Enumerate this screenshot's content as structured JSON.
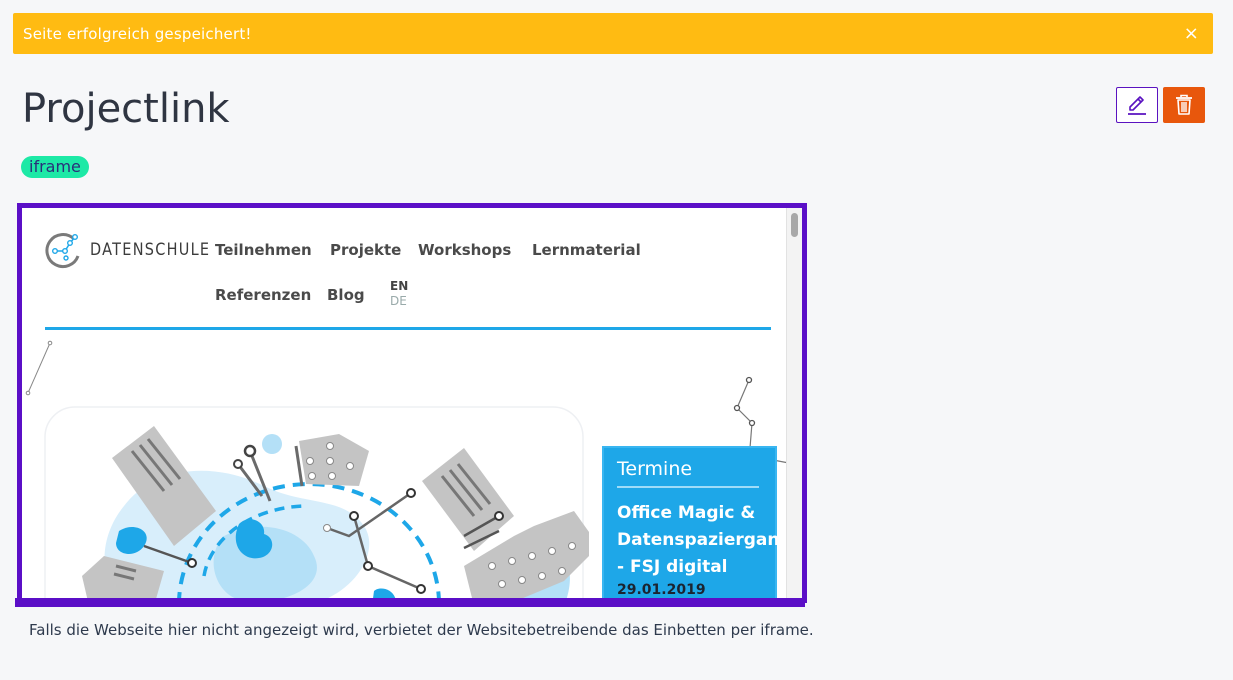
{
  "alert": {
    "message": "Seite erfolgreich gespeichert!",
    "close_label": "×"
  },
  "page": {
    "title": "Projectlink",
    "tag": "iframe"
  },
  "actions": {
    "edit_icon": "pencil-icon",
    "delete_icon": "trash-icon"
  },
  "colors": {
    "alert": "#ffbb12",
    "accent": "#5b0fc7",
    "delete": "#e8570c",
    "tag": "#1de9a6",
    "site_blue": "#1ea7e8"
  },
  "embedded_site": {
    "logo_text": "DATENSCHULE",
    "nav": [
      "Teilnehmen",
      "Projekte",
      "Workshops",
      "Lernmaterial",
      "Referenzen",
      "Blog"
    ],
    "languages": [
      "EN",
      "DE"
    ],
    "termine": {
      "heading": "Termine",
      "event_title": "Office Magic &\nDatenspaziergang\n- FSJ digital",
      "event_date": "29.01.2019"
    }
  },
  "caption": "Falls die Webseite hier nicht angezeigt wird, verbietet der Websitebetreibende das Einbetten per iframe."
}
